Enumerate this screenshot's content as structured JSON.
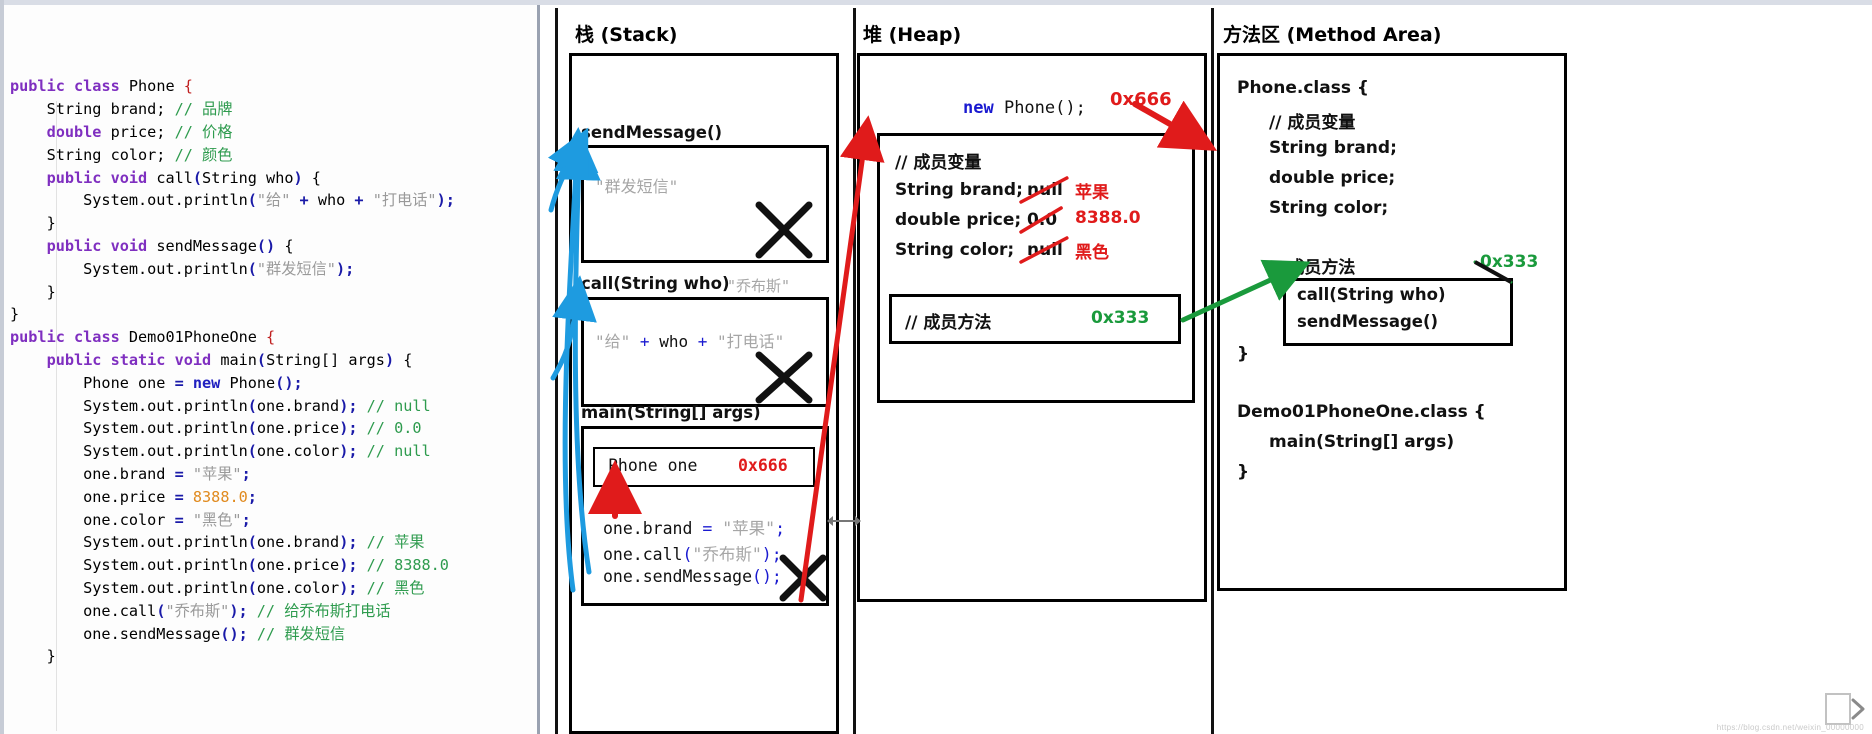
{
  "code": {
    "lines": [
      [
        {
          "t": "public ",
          "c": "kw"
        },
        {
          "t": "class ",
          "c": "kw"
        },
        {
          "t": "Phone ",
          "c": "pl"
        },
        {
          "t": "{",
          "c": "brace"
        }
      ],
      [
        {
          "t": "    String brand; ",
          "c": "pl"
        },
        {
          "t": "// 品牌",
          "c": "cm"
        }
      ],
      [
        {
          "t": "    ",
          "c": "pl"
        },
        {
          "t": "double ",
          "c": "kw"
        },
        {
          "t": "price; ",
          "c": "pl"
        },
        {
          "t": "// 价格",
          "c": "cm"
        }
      ],
      [
        {
          "t": "    String color; ",
          "c": "pl"
        },
        {
          "t": "// 颜色",
          "c": "cm"
        }
      ],
      [
        {
          "t": "    ",
          "c": "pl"
        },
        {
          "t": "public ",
          "c": "kw"
        },
        {
          "t": "void ",
          "c": "kw"
        },
        {
          "t": "call",
          "c": "pl"
        },
        {
          "t": "(",
          "c": "pn"
        },
        {
          "t": "String who",
          "c": "pl"
        },
        {
          "t": ")",
          "c": "pn"
        },
        {
          "t": " {",
          "c": "pl"
        }
      ],
      [
        {
          "t": "        System.out.println",
          "c": "pl"
        },
        {
          "t": "(",
          "c": "pn"
        },
        {
          "t": "\"给\"",
          "c": "st"
        },
        {
          "t": " + ",
          "c": "pn"
        },
        {
          "t": "who",
          "c": "pl"
        },
        {
          "t": " + ",
          "c": "pn"
        },
        {
          "t": "\"打电话\"",
          "c": "st"
        },
        {
          "t": ")",
          "c": "pn"
        },
        {
          "t": ";",
          "c": "pn"
        }
      ],
      [
        {
          "t": "    }",
          "c": "pl"
        }
      ],
      [
        {
          "t": "    ",
          "c": "pl"
        },
        {
          "t": "public ",
          "c": "kw"
        },
        {
          "t": "void ",
          "c": "kw"
        },
        {
          "t": "sendMessage",
          "c": "pl"
        },
        {
          "t": "()",
          "c": "pn"
        },
        {
          "t": " {",
          "c": "pl"
        }
      ],
      [
        {
          "t": "        System.out.println",
          "c": "pl"
        },
        {
          "t": "(",
          "c": "pn"
        },
        {
          "t": "\"群发短信\"",
          "c": "st"
        },
        {
          "t": ")",
          "c": "pn"
        },
        {
          "t": ";",
          "c": "pn"
        }
      ],
      [
        {
          "t": "    }",
          "c": "pl"
        }
      ],
      [
        {
          "t": "}",
          "c": "pl"
        }
      ],
      [
        {
          "t": "public ",
          "c": "kw"
        },
        {
          "t": "class ",
          "c": "kw"
        },
        {
          "t": "Demo01PhoneOne ",
          "c": "pl"
        },
        {
          "t": "{",
          "c": "brace"
        }
      ],
      [
        {
          "t": "    ",
          "c": "pl"
        },
        {
          "t": "public ",
          "c": "kw"
        },
        {
          "t": "static ",
          "c": "kw"
        },
        {
          "t": "void ",
          "c": "kw"
        },
        {
          "t": "main",
          "c": "pl"
        },
        {
          "t": "(",
          "c": "pn"
        },
        {
          "t": "String[] args",
          "c": "pl"
        },
        {
          "t": ")",
          "c": "pn"
        },
        {
          "t": " {",
          "c": "pl"
        }
      ],
      [
        {
          "t": "        Phone one ",
          "c": "pl"
        },
        {
          "t": "= ",
          "c": "pn"
        },
        {
          "t": "new ",
          "c": "kw2"
        },
        {
          "t": "Phone",
          "c": "pl"
        },
        {
          "t": "()",
          "c": "pn"
        },
        {
          "t": ";",
          "c": "pn"
        }
      ],
      [
        {
          "t": "        System.out.println",
          "c": "pl"
        },
        {
          "t": "(",
          "c": "pn"
        },
        {
          "t": "one.brand",
          "c": "pl"
        },
        {
          "t": ")",
          "c": "pn"
        },
        {
          "t": "; ",
          "c": "pn"
        },
        {
          "t": "// null",
          "c": "cm"
        }
      ],
      [
        {
          "t": "        System.out.println",
          "c": "pl"
        },
        {
          "t": "(",
          "c": "pn"
        },
        {
          "t": "one.price",
          "c": "pl"
        },
        {
          "t": ")",
          "c": "pn"
        },
        {
          "t": "; ",
          "c": "pn"
        },
        {
          "t": "// 0.0",
          "c": "cm"
        }
      ],
      [
        {
          "t": "        System.out.println",
          "c": "pl"
        },
        {
          "t": "(",
          "c": "pn"
        },
        {
          "t": "one.color",
          "c": "pl"
        },
        {
          "t": ")",
          "c": "pn"
        },
        {
          "t": "; ",
          "c": "pn"
        },
        {
          "t": "// null",
          "c": "cm"
        }
      ],
      [
        {
          "t": "        one.brand ",
          "c": "pl"
        },
        {
          "t": "= ",
          "c": "pn"
        },
        {
          "t": "\"苹果\"",
          "c": "st"
        },
        {
          "t": ";",
          "c": "pn"
        }
      ],
      [
        {
          "t": "        one.price ",
          "c": "pl"
        },
        {
          "t": "= ",
          "c": "pn"
        },
        {
          "t": "8388.0",
          "c": "num"
        },
        {
          "t": ";",
          "c": "pn"
        }
      ],
      [
        {
          "t": "        one.color ",
          "c": "pl"
        },
        {
          "t": "= ",
          "c": "pn"
        },
        {
          "t": "\"黑色\"",
          "c": "st"
        },
        {
          "t": ";",
          "c": "pn"
        }
      ],
      [
        {
          "t": "        System.out.println",
          "c": "pl"
        },
        {
          "t": "(",
          "c": "pn"
        },
        {
          "t": "one.brand",
          "c": "pl"
        },
        {
          "t": ")",
          "c": "pn"
        },
        {
          "t": "; ",
          "c": "pn"
        },
        {
          "t": "// 苹果",
          "c": "cm"
        }
      ],
      [
        {
          "t": "        System.out.println",
          "c": "pl"
        },
        {
          "t": "(",
          "c": "pn"
        },
        {
          "t": "one.price",
          "c": "pl"
        },
        {
          "t": ")",
          "c": "pn"
        },
        {
          "t": "; ",
          "c": "pn"
        },
        {
          "t": "// 8388.0",
          "c": "cm"
        }
      ],
      [
        {
          "t": "        System.out.println",
          "c": "pl"
        },
        {
          "t": "(",
          "c": "pn"
        },
        {
          "t": "one.color",
          "c": "pl"
        },
        {
          "t": ")",
          "c": "pn"
        },
        {
          "t": "; ",
          "c": "pn"
        },
        {
          "t": "// 黑色",
          "c": "cm"
        }
      ],
      [
        {
          "t": "        one.call",
          "c": "pl"
        },
        {
          "t": "(",
          "c": "pn"
        },
        {
          "t": "\"乔布斯\"",
          "c": "st"
        },
        {
          "t": ")",
          "c": "pn"
        },
        {
          "t": "; ",
          "c": "pn"
        },
        {
          "t": "// 给乔布斯打电话",
          "c": "cm"
        }
      ],
      [
        {
          "t": "        one.sendMessage",
          "c": "pl"
        },
        {
          "t": "()",
          "c": "pn"
        },
        {
          "t": "; ",
          "c": "pn"
        },
        {
          "t": "// 群发短信",
          "c": "cm"
        }
      ],
      [
        {
          "t": "    }",
          "c": "pl"
        }
      ]
    ]
  },
  "stack": {
    "title": "栈 (Stack)",
    "frames": [
      {
        "name": "sendMessage()",
        "arg": "",
        "body": "\"群发短信\"",
        "crossed": true
      },
      {
        "name": "call(String who)",
        "arg": "\"乔布斯\"",
        "body_parts": [
          {
            "t": "\"给\"",
            "c": "gray"
          },
          {
            "t": " + ",
            "c": "blue"
          },
          {
            "t": "who",
            "c": "dark"
          },
          {
            "t": " + ",
            "c": "blue"
          },
          {
            "t": "\"打电话\"",
            "c": "gray"
          }
        ],
        "crossed": true
      },
      {
        "name": "main(String[] args)",
        "variable_label": "Phone one",
        "variable_value": "0x666",
        "statements": [
          [
            {
              "t": "one.brand",
              "c": "dark"
            },
            {
              "t": " = ",
              "c": "blue"
            },
            {
              "t": "\"苹果\"",
              "c": "gray"
            },
            {
              "t": ";",
              "c": "blue"
            }
          ],
          [
            {
              "t": "one.call",
              "c": "dark"
            },
            {
              "t": "(",
              "c": "blue"
            },
            {
              "t": "\"乔布斯\"",
              "c": "gray"
            },
            {
              "t": ")",
              "c": "blue"
            },
            {
              "t": ";",
              "c": "blue"
            }
          ],
          [
            {
              "t": "one.sendMessage",
              "c": "dark"
            },
            {
              "t": "();",
              "c": "blue"
            }
          ]
        ],
        "crossed_last": true
      }
    ]
  },
  "heap": {
    "title": "堆 (Heap)",
    "new_expr_new": "new",
    "new_expr_rest": " Phone();",
    "address": "0x666",
    "member_vars_comment": "// 成员变量",
    "fields": [
      {
        "decl": "String brand;",
        "old": "null",
        "new": "苹果"
      },
      {
        "decl": "double price;",
        "old": "0.0",
        "new": "8388.0"
      },
      {
        "decl": "String color;",
        "old": "null",
        "new": "黑色"
      }
    ],
    "member_methods_comment": "// 成员方法",
    "method_address": "0x333"
  },
  "method_area": {
    "title": "方法区 (Method Area)",
    "class1_header": "Phone.class {",
    "class1_member_vars_comment": "// 成员变量",
    "class1_fields": [
      "String brand;",
      "double price;",
      "String color;"
    ],
    "class1_member_methods_comment": "// 成员方法",
    "class1_method_address": "0x333",
    "class1_methods": [
      "call(String who)",
      "sendMessage()"
    ],
    "class1_close": "}",
    "class2_header": "Demo01PhoneOne.class {",
    "class2_methods": [
      "main(String[] args)"
    ],
    "class2_close": "}"
  },
  "watermark": "https://blog.csdn.net/weixin_00000000",
  "colors": {
    "red": "#e01b1b",
    "green": "#1a9a3c",
    "blue_arrow": "#1e9be0",
    "keyword": "#7f2fc0",
    "comment": "#2e9b4e",
    "string": "#9a9a9a",
    "number": "#e08a1e"
  }
}
